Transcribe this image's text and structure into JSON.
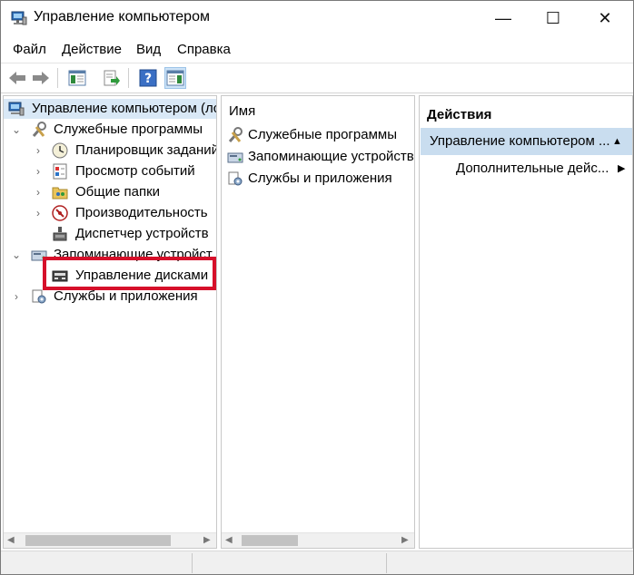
{
  "window": {
    "title": "Управление компьютером",
    "min_label": "—",
    "max_label": "☐",
    "close_label": "✕"
  },
  "menu": [
    "Файл",
    "Действие",
    "Вид",
    "Справка"
  ],
  "tree": {
    "root": "Управление компьютером (лс",
    "system_tools": "Служебные программы",
    "task_scheduler": "Планировщик заданий",
    "event_viewer": "Просмотр событий",
    "shared_folders": "Общие папки",
    "performance": "Производительность",
    "device_manager": "Диспетчер устройств",
    "storage": "Запоминающие устройст",
    "disk_management": "Управление дисками",
    "services_apps": "Службы и приложения"
  },
  "middle": {
    "column_header": "Имя",
    "items": [
      "Служебные программы",
      "Запоминающие устройства",
      "Службы и приложения"
    ]
  },
  "actions": {
    "header": "Действия",
    "selected": "Управление компьютером ...",
    "more": "Дополнительные дейс..."
  },
  "colors": {
    "highlight_box": "#d6102a",
    "selection": "#c9ddef"
  }
}
